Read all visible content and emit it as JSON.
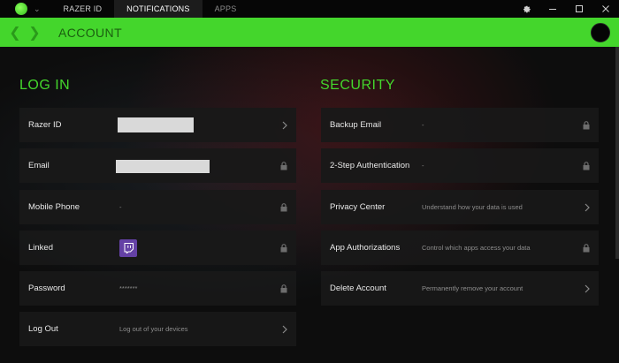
{
  "topbar": {
    "tabs": [
      {
        "label": "RAZER ID"
      },
      {
        "label": "NOTIFICATIONS"
      },
      {
        "label": "APPS"
      }
    ],
    "controls": {
      "settings_icon": "gear-icon",
      "minimize_icon": "minimize-icon",
      "maximize_icon": "maximize-icon",
      "close_icon": "close-icon"
    }
  },
  "header": {
    "title": "ACCOUNT",
    "accent_color": "#44d62c"
  },
  "login": {
    "title": "LOG IN",
    "rows": [
      {
        "label": "Razer ID",
        "value": "",
        "end_icon": "chevron-right-icon"
      },
      {
        "label": "Email",
        "value": "",
        "end_icon": "lock-icon"
      },
      {
        "label": "Mobile Phone",
        "value": "-",
        "end_icon": "lock-icon"
      },
      {
        "label": "Linked",
        "value": "",
        "end_icon": "lock-icon"
      },
      {
        "label": "Password",
        "value": "*******",
        "end_icon": "lock-icon"
      },
      {
        "label": "Log Out",
        "value": "Log out of your devices",
        "end_icon": "chevron-right-icon"
      }
    ]
  },
  "security": {
    "title": "SECURITY",
    "rows": [
      {
        "label": "Backup Email",
        "value": "-",
        "end_icon": "lock-icon"
      },
      {
        "label": "2-Step Authentication",
        "value": "-",
        "end_icon": "lock-icon"
      },
      {
        "label": "Privacy Center",
        "value": "Understand how your data is used",
        "end_icon": "chevron-right-icon"
      },
      {
        "label": "App Authorizations",
        "value": "Control which apps access your data",
        "end_icon": "lock-icon"
      },
      {
        "label": "Delete Account",
        "value": "Permanently remove your account",
        "end_icon": "chevron-right-icon"
      }
    ]
  }
}
